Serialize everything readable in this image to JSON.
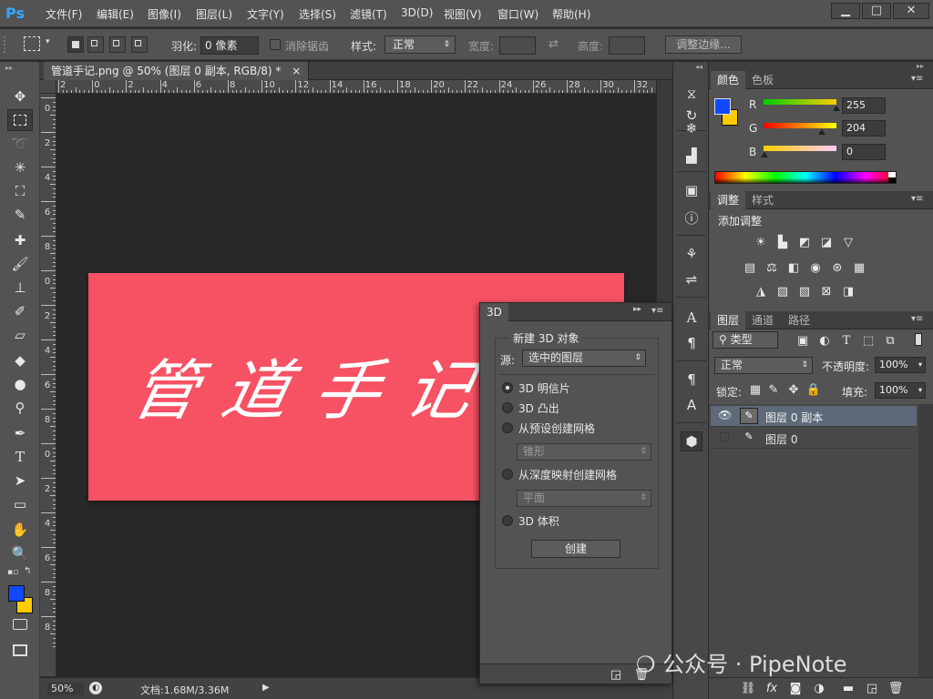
{
  "app": {
    "logo": "Ps"
  },
  "menu": [
    "文件(F)",
    "编辑(E)",
    "图像(I)",
    "图层(L)",
    "文字(Y)",
    "选择(S)",
    "滤镜(T)",
    "3D(D)",
    "视图(V)",
    "窗口(W)",
    "帮助(H)"
  ],
  "window_controls": {
    "minimize": "▁",
    "maximize": "□",
    "close": "✕"
  },
  "options": {
    "feather_label": "羽化:",
    "feather_value": "0 像素",
    "antialias_label": "消除锯齿",
    "style_label": "样式:",
    "style_value": "正常",
    "width_label": "宽度:",
    "height_label": "高度:",
    "refine_edge": "调整边缘..."
  },
  "document": {
    "tab_title": "管道手记.png @ 50% (图层 0 副本, RGB/8) *",
    "tab_close": "×",
    "artwork_text": "管道手记",
    "artwork_color": "#f65263",
    "ruler_h": [
      "2",
      "0",
      "2",
      "4",
      "6",
      "8",
      "10",
      "12",
      "14",
      "16",
      "18",
      "20",
      "22",
      "24",
      "26",
      "28",
      "30",
      "32"
    ],
    "ruler_v": [
      "0",
      "2",
      "4",
      "6",
      "8",
      "0",
      "2",
      "4",
      "6",
      "8",
      "0",
      "2",
      "4",
      "6",
      "8",
      "8"
    ],
    "zoom": "50%",
    "doc_info": "文档:1.68M/3.36M"
  },
  "color_panel": {
    "tabs": [
      "颜色",
      "色板"
    ],
    "foreground": "#1248ff",
    "background": "#ffcc00",
    "r_label": "R",
    "r_value": "255",
    "g_label": "G",
    "g_value": "204",
    "b_label": "B",
    "b_value": "0"
  },
  "adjust_panel": {
    "tabs": [
      "调整",
      "样式"
    ],
    "heading": "添加调整"
  },
  "layers_panel": {
    "tabs": [
      "图层",
      "通道",
      "路径"
    ],
    "filter_label": "类型",
    "blend_mode": "正常",
    "opacity_label": "不透明度:",
    "opacity_value": "100%",
    "lock_label": "锁定:",
    "fill_label": "填充:",
    "fill_value": "100%",
    "layers": [
      {
        "name": "图层 0 副本",
        "visible": true,
        "selected": true
      },
      {
        "name": "图层 0",
        "visible": false,
        "selected": false
      }
    ]
  },
  "panel3d": {
    "tab": "3D",
    "group_title": "新建 3D 对象",
    "source_label": "源:",
    "source_value": "选中的图层",
    "options": [
      "3D 明信片",
      "3D 凸出",
      "从预设创建网格",
      "从深度映射创建网格",
      "3D 体积"
    ],
    "selected_option": 0,
    "preset_value": "锥形",
    "depth_value": "平面",
    "create_button": "创建"
  },
  "watermark": "公众号 · PipeNote"
}
